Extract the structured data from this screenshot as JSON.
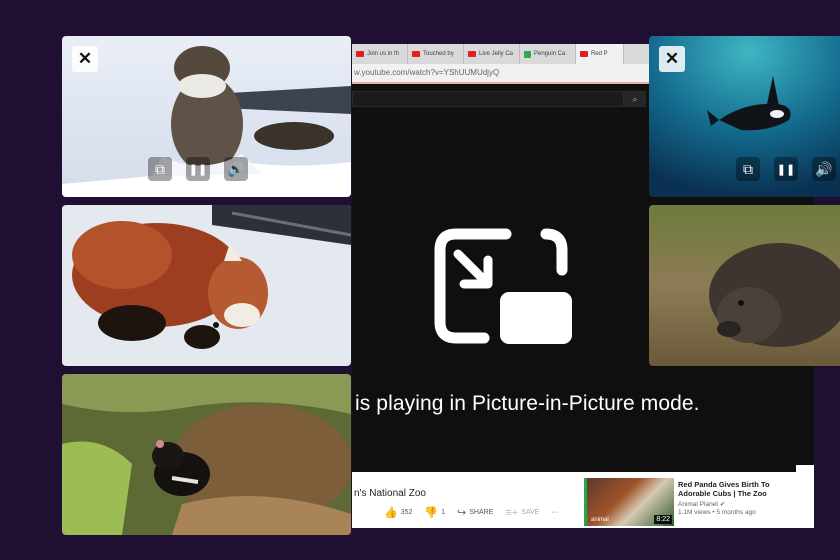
{
  "browser": {
    "tabs": [
      {
        "label": "Join us in th",
        "icon": "youtube-favicon-icon"
      },
      {
        "label": "Touched by",
        "icon": "youtube-favicon-icon"
      },
      {
        "label": "Live Jelly Ca",
        "icon": "youtube-favicon-icon"
      },
      {
        "label": "Penguin Ca",
        "icon": "green-z-favicon-icon"
      },
      {
        "label": "Red P",
        "icon": "youtube-favicon-icon"
      }
    ],
    "url": "w.youtube.com/watch?v=YShUUMUdjyQ",
    "pip_message": "is playing in Picture-in-Picture mode.",
    "video_title_fragment": "n's National Zoo",
    "like_count": "352",
    "dislike_count": "1",
    "share_label": "SHARE",
    "save_label": "SAVE",
    "more_label": "···",
    "recommended": {
      "title": "Red Panda Gives Birth To Adorable Cubs | The Zoo",
      "channel": "Animal Planet ✔",
      "meta": "1.1M views • 5 months ago",
      "duration": "8:22",
      "watermark": "animal"
    }
  },
  "pip_windows": [
    {
      "name": "otter",
      "has_controls": true
    },
    {
      "name": "orca",
      "has_controls": true
    },
    {
      "name": "red-panda",
      "has_controls": false
    },
    {
      "name": "wombat",
      "has_controls": false
    },
    {
      "name": "tasmanian-devil",
      "has_controls": false
    }
  ],
  "icons": {
    "close": "✕",
    "pause": "❚❚",
    "volume": "🔊",
    "back_to_tab": "⧉",
    "search": "⌕",
    "like": "👍",
    "dislike": "👎",
    "share": "↪",
    "save": "≡+"
  },
  "colors": {
    "desktop": "#1e0f33",
    "player_bg": "#0f0f0f",
    "accent_green": "#29a84a"
  }
}
